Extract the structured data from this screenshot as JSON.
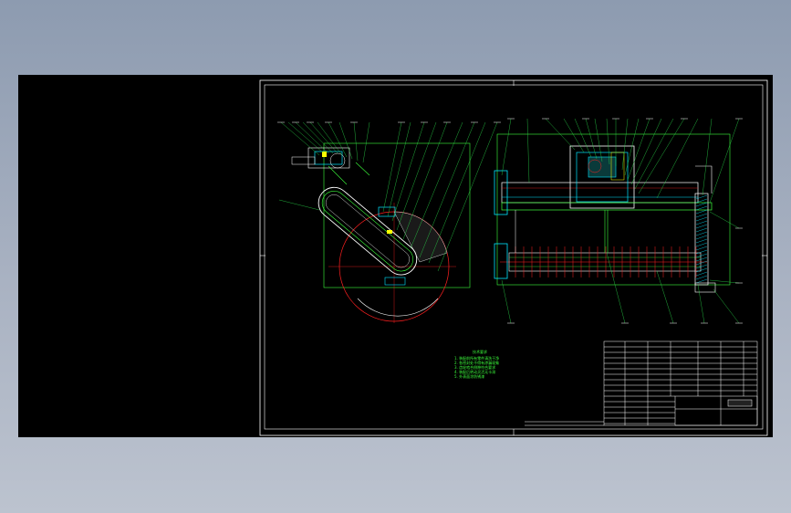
{
  "colors": {
    "background_gradient_top": "#8d9bb0",
    "background_gradient_bottom": "#bcc3cf",
    "model_space": "#000000",
    "frame": "#ffffff",
    "outline": "#ffffff",
    "construction": "#ff2020",
    "section_green": "#3cff3c",
    "hatch_cyan": "#00e5ff",
    "leader_green": "#2bd94a",
    "accent_yellow": "#ffff00"
  },
  "icons": {
    "sheet": "cad-drawing-sheet",
    "left_view": "side-section-view",
    "right_view": "front-section-view",
    "notes": "technical-requirements-notes",
    "title_block": "title-block-table"
  },
  "tech_notes": {
    "heading": "技术要求",
    "lines": [
      "1. 装配前所有零件清洗干净",
      "2. 各密封处不得有渗漏现象",
      "3. 齿轮啮合侧隙符合要求",
      "4. 装配后转动灵活无卡滞",
      "5. 外表面涂防锈漆"
    ]
  }
}
